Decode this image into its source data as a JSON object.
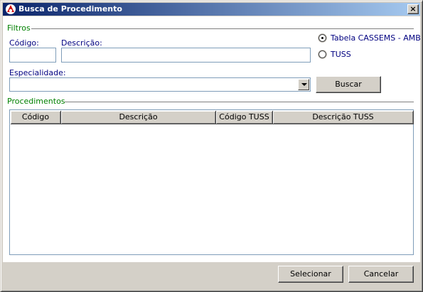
{
  "window": {
    "title": "Busca de Procedimento",
    "close_glyph": "×"
  },
  "filtros": {
    "section_label": "Filtros",
    "codigo_label": "Código:",
    "codigo_value": "",
    "descricao_label": "Descrição:",
    "descricao_value": "",
    "especialidade_label": "Especialidade:",
    "especialidade_value": "",
    "radio_options": [
      {
        "label": "Tabela CASSEMS - AMB",
        "checked": true
      },
      {
        "label": "TUSS",
        "checked": false
      }
    ],
    "buscar_label": "Buscar"
  },
  "procedimentos": {
    "section_label": "Procedimentos",
    "columns": [
      "Código",
      "Descrição",
      "Código TUSS",
      "Descrição TUSS"
    ],
    "rows": []
  },
  "footer": {
    "selecionar_label": "Selecionar",
    "cancelar_label": "Cancelar"
  },
  "colors": {
    "title_gradient_start": "#0a246a",
    "title_gradient_end": "#a6caf0",
    "section_label": "#008000",
    "field_label": "#000080",
    "window_face": "#d4d0c8"
  }
}
